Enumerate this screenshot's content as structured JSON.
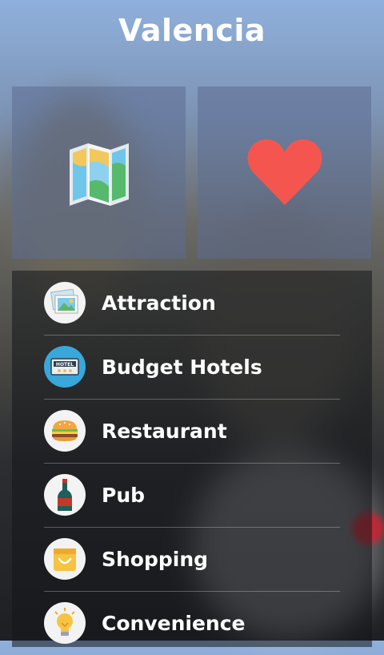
{
  "header": {
    "title": "Valencia"
  },
  "tiles": [
    {
      "name": "map",
      "icon": "map-icon"
    },
    {
      "name": "favorites",
      "icon": "heart-icon"
    }
  ],
  "menu": {
    "items": [
      {
        "label": "Attraction",
        "icon": "photo-icon"
      },
      {
        "label": "Budget Hotels",
        "icon": "hotel-sign-icon"
      },
      {
        "label": "Restaurant",
        "icon": "burger-icon"
      },
      {
        "label": "Pub",
        "icon": "wine-bottle-icon"
      },
      {
        "label": "Shopping",
        "icon": "shopping-bag-icon"
      },
      {
        "label": "Convenience",
        "icon": "lightbulb-icon"
      }
    ]
  },
  "colors": {
    "heart": "#f4564f",
    "tile": "#5d6e91"
  }
}
